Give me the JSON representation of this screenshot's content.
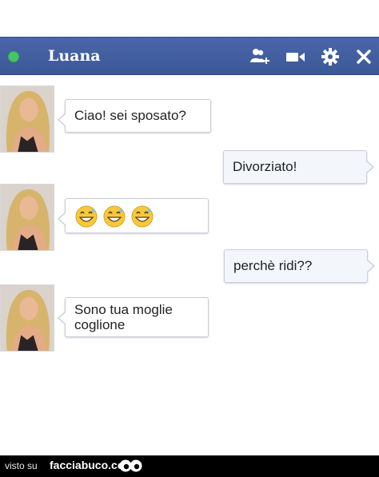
{
  "chat_header": {
    "contact_name": "Luana",
    "status": "online",
    "icons": [
      "add-friend-icon",
      "video-call-icon",
      "gear-icon",
      "close-icon"
    ]
  },
  "messages": [
    {
      "direction": "incoming",
      "text": "Ciao! sei sposato?"
    },
    {
      "direction": "outgoing",
      "text": "Divorziato!"
    },
    {
      "direction": "incoming",
      "emojis": [
        "grinning-sweat-emoji",
        "grinning-sweat-emoji",
        "grinning-sweat-emoji"
      ]
    },
    {
      "direction": "outgoing",
      "text": "perchè ridi??"
    },
    {
      "direction": "incoming",
      "text_lines": [
        "Sono tua moglie",
        "coglione"
      ]
    }
  ],
  "footer": {
    "prefix": "visto su",
    "site": "facciabuco.com"
  },
  "colors": {
    "header_bg": "#3b5898",
    "status_online": "#44c667",
    "bubble_border": "#c9cdd6",
    "outgoing_bg": "#f3f6fb"
  }
}
